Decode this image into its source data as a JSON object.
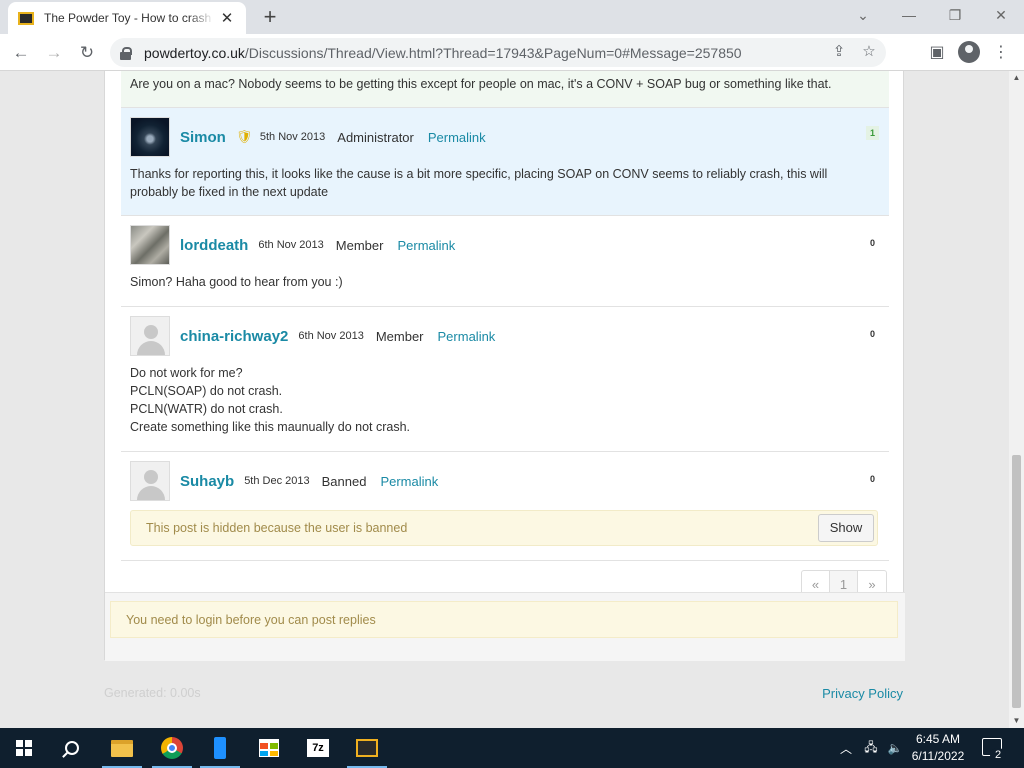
{
  "browser": {
    "tab_title": "The Powder Toy - How to crash T",
    "tab_close": "✕",
    "new_tab": "+",
    "url_host": "powdertoy.co.uk",
    "url_path": "/Discussions/Thread/View.html?Thread=17943&PageNum=0#Message=257850"
  },
  "posts": [
    {
      "body": "Are you on a mac? Nobody seems to be getting this except for people on mac, it's a CONV + SOAP bug or something like that."
    },
    {
      "username": "Simon",
      "date": "5th Nov 2013",
      "role": "Administrator",
      "permalink": "Permalink",
      "score": "1",
      "body": "Thanks for reporting this, it looks like the cause is a bit more specific, placing SOAP on CONV seems to reliably crash, this will probably be fixed in the next update"
    },
    {
      "username": "lorddeath",
      "date": "6th Nov 2013",
      "role": "Member",
      "permalink": "Permalink",
      "score": "0",
      "body": "Simon? Haha good to hear from you :)"
    },
    {
      "username": "china-richway2",
      "date": "6th Nov 2013",
      "role": "Member",
      "permalink": "Permalink",
      "score": "0",
      "body_lines": [
        "Do not work for me?",
        "PCLN(SOAP) do not crash.",
        "PCLN(WATR) do not crash.",
        "Create something like this maunually do not crash."
      ]
    },
    {
      "username": "Suhayb",
      "date": "5th Dec 2013",
      "role": "Banned",
      "permalink": "Permalink",
      "score": "0",
      "hidden_text": "This post is hidden because the user is banned",
      "show_label": "Show"
    }
  ],
  "pagination": {
    "prev": "«",
    "current": "1",
    "next": "»"
  },
  "login_notice": "You need to login before you can post replies",
  "footer": {
    "generated": "Generated: 0.00s",
    "privacy": "Privacy Policy"
  },
  "taskbar": {
    "time": "6:45 AM",
    "date": "6/11/2022",
    "notification_count": "2",
    "sevenzip_label": "7z"
  }
}
